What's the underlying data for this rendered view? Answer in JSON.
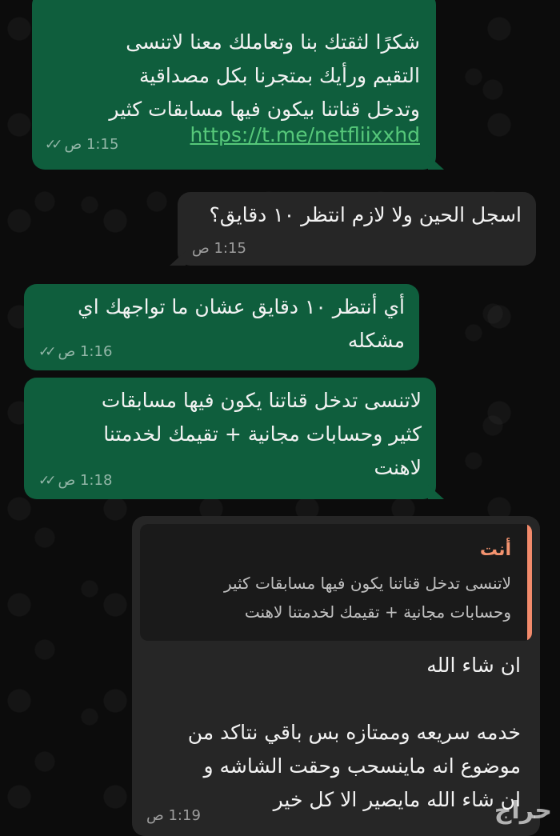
{
  "messages": [
    {
      "id": "m1",
      "direction": "outgoing",
      "text": "شكرًا لثقتك بنا وتعاملك معنا لاتنسى\nالتقيم ورأيك بمتجرنا بكل مصداقية\nوتدخل قناتنا بيكون فيها مسابقات كثير",
      "link": "https://t.me/netfliixxhd",
      "time": "1:15 ص",
      "status_icon": "double-check-read"
    },
    {
      "id": "m2",
      "direction": "incoming",
      "text": "اسجل الحين ولا لازم انتظر ١٠ دقايق؟",
      "time": "1:15 ص"
    },
    {
      "id": "m3",
      "direction": "outgoing",
      "text": "أي أنتظر ١٠ دقايق عشان ما تواجهك اي\nمشكله",
      "time": "1:16 ص",
      "status_icon": "double-check-read"
    },
    {
      "id": "m4",
      "direction": "outgoing",
      "text": "لاتنسى تدخل قناتنا يكون فيها مسابقات\nكثير وحسابات مجانية + تقيمك لخدمتنا\nلاهنت",
      "time": "1:18 ص",
      "status_icon": "double-check-read"
    },
    {
      "id": "m5",
      "direction": "incoming",
      "reply": {
        "author": "أنت",
        "text": "لاتنسى تدخل قناتنا يكون فيها مسابقات كثير\nوحسابات مجانية + تقيمك لخدمتنا لاهنت"
      },
      "text": "ان شاء الله\n\nخدمه سريعه وممتازه بس باقي نتاكد من\nموضوع انه ماينسحب وحقت الشاشه و\nان شاء الله مايصير الا كل خير",
      "time": "1:19 ص"
    }
  ],
  "watermark": "حراج",
  "colors": {
    "outgoing_bubble": "#0f5e3d",
    "incoming_bubble": "#262626",
    "link": "#56c87a",
    "reply_accent": "#f28a6b"
  }
}
